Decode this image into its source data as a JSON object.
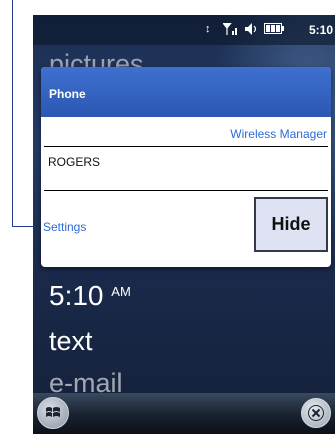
{
  "status_bar": {
    "time": "5:10"
  },
  "home": {
    "pictures_label": "pictures",
    "clock_time": "5:10",
    "clock_ampm": "AM",
    "text_label": "text",
    "email_label": "e-mail"
  },
  "dialog": {
    "title": "Phone",
    "wireless_manager_link": "Wireless Manager",
    "operator": "ROGERS",
    "settings_link": "Settings",
    "hide_button": "Hide"
  },
  "icons": {
    "start": "windows-logo-icon",
    "close": "close-x-icon",
    "signal": "signal-icon",
    "volume": "speaker-icon",
    "battery": "battery-icon",
    "sync": "connection-icon"
  },
  "colors": {
    "header_blue": "#3f70cf",
    "link_blue": "#2e6bd6"
  }
}
